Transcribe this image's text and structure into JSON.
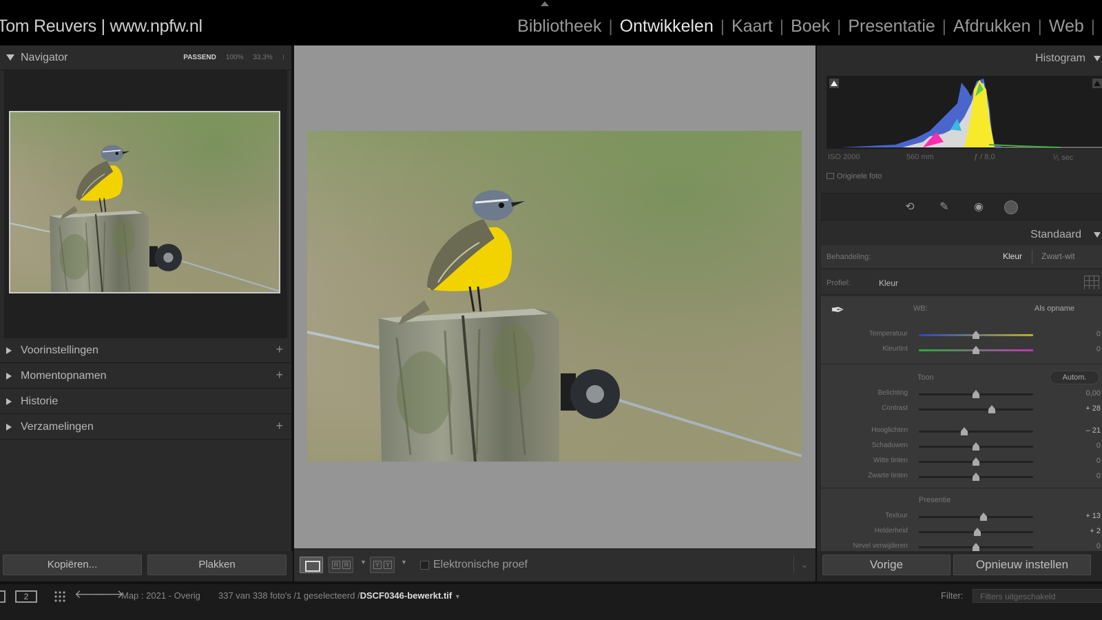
{
  "identity": "Tom Reuvers | www.npfw.nl",
  "modules": [
    {
      "label": "Bibliotheek",
      "active": false
    },
    {
      "label": "Ontwikkelen",
      "active": true
    },
    {
      "label": "Kaart",
      "active": false
    },
    {
      "label": "Boek",
      "active": false
    },
    {
      "label": "Presentatie",
      "active": false
    },
    {
      "label": "Afdrukken",
      "active": false
    },
    {
      "label": "Web",
      "active": false
    }
  ],
  "left_panel": {
    "navigator": {
      "title": "Navigator",
      "zoom_options": [
        "PASSEND",
        "100%",
        "33,3%"
      ],
      "selected_zoom": "PASSEND"
    },
    "sections": [
      {
        "label": "Voorinstellingen",
        "plus": "+"
      },
      {
        "label": "Momentopnamen",
        "plus": "+"
      },
      {
        "label": "Historie",
        "plus": ""
      },
      {
        "label": "Verzamelingen",
        "plus": "+"
      }
    ],
    "copy_label": "Kopiëren...",
    "paste_label": "Plakken"
  },
  "toolbar": {
    "proof_label": "Elektronische proef",
    "proof_checked": false
  },
  "right_panel": {
    "histogram": {
      "title": "Histogram",
      "iso": "ISO 2000",
      "focal": "560 mm",
      "aperture": "ƒ / 8,0",
      "shutter": "⅟₁ sec",
      "original_label": "Originele foto"
    },
    "basic": {
      "preset_label": "Standaard",
      "treatment_label": "Behandeling:",
      "treatment_color": "Kleur",
      "treatment_bw": "Zwart-wit",
      "profile_label": "Profiel:",
      "profile_value": "Kleur",
      "wb_label": "WB:",
      "wb_value": "Als opname",
      "tone_label": "Toon",
      "auto_label": "Autom.",
      "presence_label": "Presentie",
      "sliders": {
        "temperature": {
          "label": "Temperatuur",
          "value": "0",
          "position": 0.5
        },
        "tint": {
          "label": "Kleurtint",
          "value": "0",
          "position": 0.5
        },
        "exposure": {
          "label": "Belichting",
          "value": "0,00",
          "position": 0.5
        },
        "contrast": {
          "label": "Contrast",
          "value": "+ 28",
          "position": 0.64
        },
        "highlights": {
          "label": "Hooglichten",
          "value": "– 21",
          "position": 0.395
        },
        "shadows": {
          "label": "Schaduwen",
          "value": "0",
          "position": 0.5
        },
        "whites": {
          "label": "Witte tinten",
          "value": "0",
          "position": 0.5
        },
        "blacks": {
          "label": "Zwarte tinten",
          "value": "0",
          "position": 0.5
        },
        "texture": {
          "label": "Textuur",
          "value": "+ 13",
          "position": 0.565
        },
        "clarity": {
          "label": "Helderheid",
          "value": "+ 2",
          "position": 0.51
        },
        "dehaze": {
          "label": "Nevel verwijderen",
          "value": "0",
          "position": 0.5
        }
      }
    },
    "prev_label": "Vorige",
    "reset_label": "Opnieuw instellen"
  },
  "filmstrip": {
    "monitor2_label": "2",
    "folder": "Map : 2021 - Overig",
    "selection": "337 van 338 foto's /1 geselecteerd /",
    "filename": "DSCF0346-bewerkt.tif",
    "filter_label": "Filter:",
    "filter_value": "Filters uitgeschakeld"
  }
}
